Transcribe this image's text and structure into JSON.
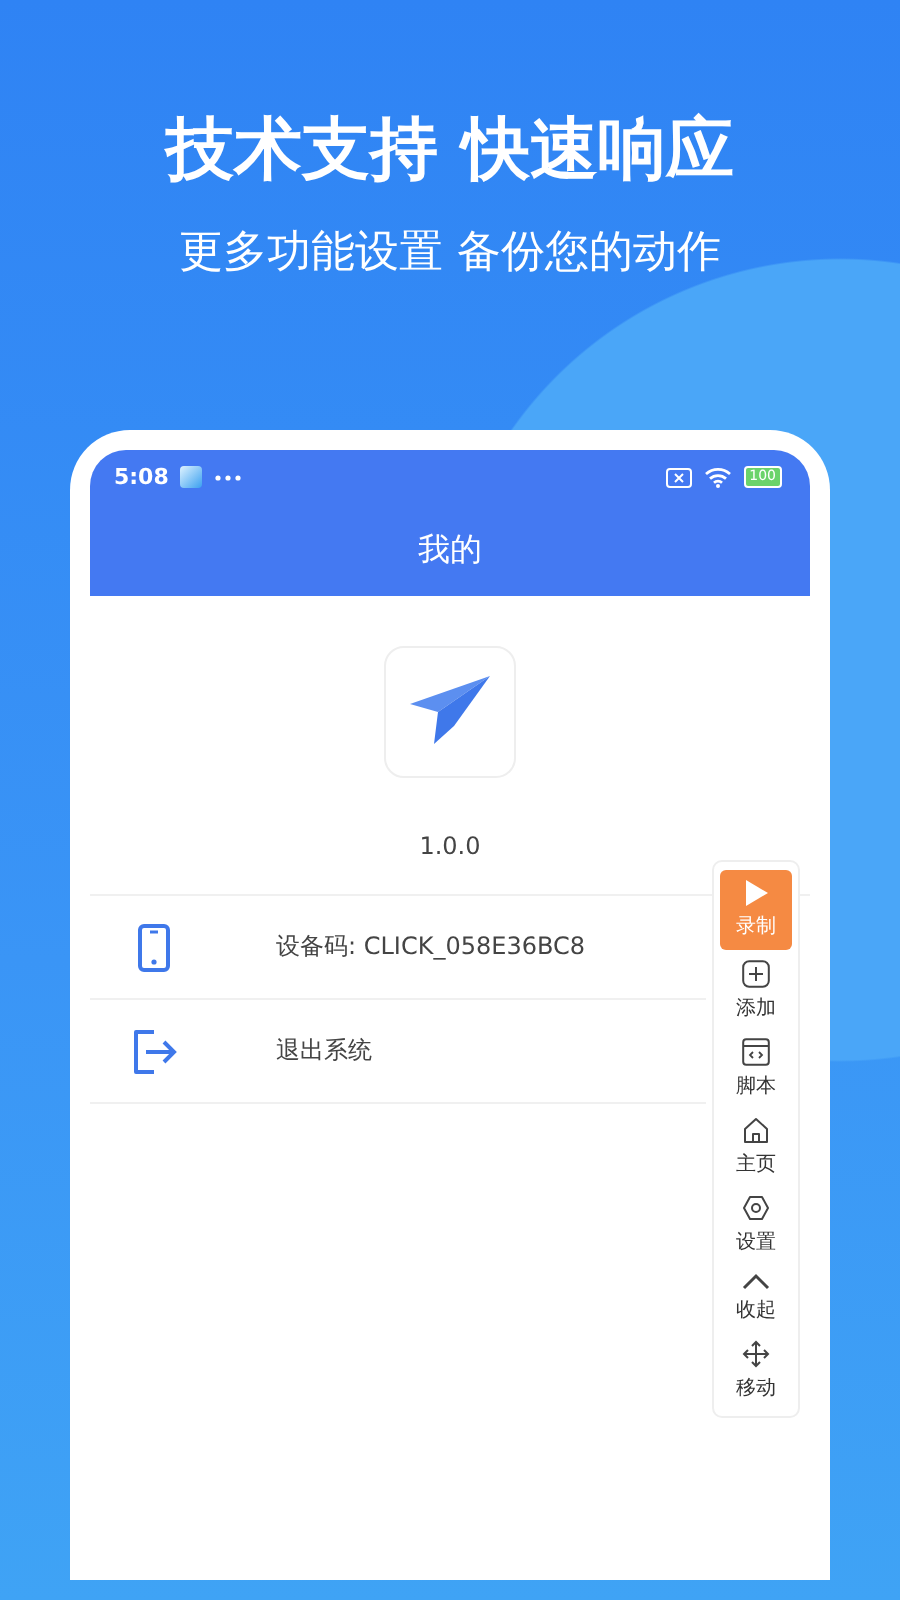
{
  "headline": "技术支持 快速响应",
  "subheadline": "更多功能设置 备份您的动作",
  "status_bar": {
    "time": "5:08",
    "battery": "100"
  },
  "app_bar": {
    "title": "我的"
  },
  "version": "1.0.0",
  "menu": [
    {
      "kind": "device",
      "label": "设备码: CLICK_058E36BC8"
    },
    {
      "kind": "logout",
      "label": "退出系统"
    }
  ],
  "toolbar": [
    {
      "kind": "record",
      "label": "录制",
      "selected": true
    },
    {
      "kind": "add",
      "label": "添加",
      "selected": false
    },
    {
      "kind": "script",
      "label": "脚本",
      "selected": false
    },
    {
      "kind": "home",
      "label": "主页",
      "selected": false
    },
    {
      "kind": "settings",
      "label": "设置",
      "selected": false
    },
    {
      "kind": "collapse",
      "label": "收起",
      "selected": false
    },
    {
      "kind": "move",
      "label": "移动",
      "selected": false
    }
  ]
}
